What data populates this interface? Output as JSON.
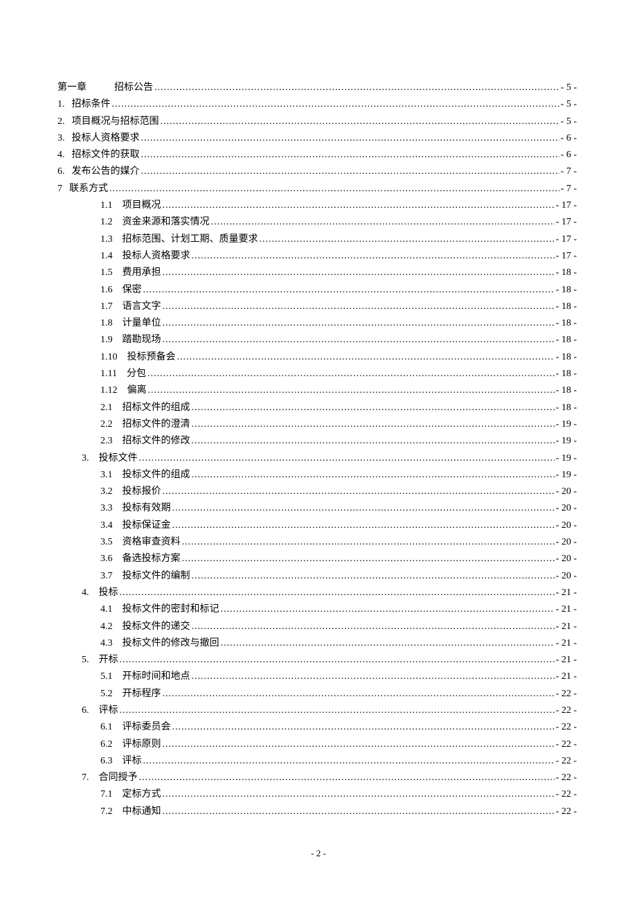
{
  "footer": "- 2 -",
  "toc": [
    {
      "level": 0,
      "label": "第一章",
      "gap": "big",
      "title": "招标公告",
      "page": "- 5 -"
    },
    {
      "level": 0,
      "label": "1.",
      "gap": "small",
      "title": "招标条件",
      "page": "- 5 -"
    },
    {
      "level": 0,
      "label": "2.",
      "gap": "small",
      "title": "项目概况与招标范围",
      "page": "- 5 -"
    },
    {
      "level": 0,
      "label": "3.",
      "gap": "small",
      "title": "投标人资格要求",
      "page": "- 6 -"
    },
    {
      "level": 0,
      "label": "4.",
      "gap": "small",
      "title": "招标文件的获取",
      "page": "- 6 -"
    },
    {
      "level": 0,
      "label": "6.",
      "gap": "small",
      "title": "发布公告的媒介",
      "page": "- 7 -"
    },
    {
      "level": 0,
      "label": "7",
      "gap": "small",
      "title": "联系方式",
      "page": "- 7 -"
    },
    {
      "level": 1,
      "label": "1.1",
      "gap": "med",
      "title": "项目概况",
      "page": "- 17 -"
    },
    {
      "level": 1,
      "label": "1.2",
      "gap": "med",
      "title": "资金来源和落实情况",
      "page": "- 17 -"
    },
    {
      "level": 1,
      "label": "1.3",
      "gap": "med",
      "title": "招标范围、计划工期、质量要求",
      "page": "- 17 -"
    },
    {
      "level": 1,
      "label": "1.4",
      "gap": "med",
      "title": "投标人资格要求",
      "page": "- 17 -"
    },
    {
      "level": 1,
      "label": "1.5",
      "gap": "med",
      "title": "费用承担",
      "page": "- 18 -"
    },
    {
      "level": 1,
      "label": "1.6",
      "gap": "med",
      "title": "保密",
      "page": "- 18 -"
    },
    {
      "level": 1,
      "label": "1.7",
      "gap": "med",
      "title": "语言文字",
      "page": "- 18 -"
    },
    {
      "level": 1,
      "label": "1.8",
      "gap": "med",
      "title": "计量单位",
      "page": "- 18 -"
    },
    {
      "level": 1,
      "label": "1.9",
      "gap": "med",
      "title": "踏勘现场",
      "page": "- 18 -"
    },
    {
      "level": 1,
      "label": "1.10",
      "gap": "med",
      "title": "投标预备会",
      "page": "- 18 -"
    },
    {
      "level": 1,
      "label": "1.11",
      "gap": "med",
      "title": "分包",
      "page": "- 18 -"
    },
    {
      "level": 1,
      "label": "1.12",
      "gap": "med",
      "title": "偏离",
      "page": "- 18 -"
    },
    {
      "level": 1,
      "label": "2.1",
      "gap": "med",
      "title": "招标文件的组成",
      "page": "- 18 -"
    },
    {
      "level": 1,
      "label": "2.2",
      "gap": "med",
      "title": "招标文件的澄清",
      "page": "- 19 -"
    },
    {
      "level": 1,
      "label": "2.3",
      "gap": "med",
      "title": "招标文件的修改",
      "page": "- 19 -"
    },
    {
      "level": 2,
      "label": "3.",
      "gap": "med",
      "title": "投标文件",
      "page": "- 19 -"
    },
    {
      "level": 1,
      "label": "3.1",
      "gap": "med",
      "title": "投标文件的组成",
      "page": "- 19 -"
    },
    {
      "level": 1,
      "label": "3.2",
      "gap": "med",
      "title": "投标报价",
      "page": "- 20 -"
    },
    {
      "level": 1,
      "label": "3.3",
      "gap": "med",
      "title": "投标有效期",
      "page": "- 20 -"
    },
    {
      "level": 1,
      "label": "3.4",
      "gap": "med",
      "title": "投标保证金",
      "page": "- 20 -"
    },
    {
      "level": 1,
      "label": "3.5",
      "gap": "med",
      "title": "资格审查资料",
      "page": "- 20 -"
    },
    {
      "level": 1,
      "label": "3.6",
      "gap": "med",
      "title": "备选投标方案",
      "page": "- 20 -"
    },
    {
      "level": 1,
      "label": "3.7",
      "gap": "med",
      "title": "投标文件的编制",
      "page": "- 20 -"
    },
    {
      "level": 2,
      "label": "4.",
      "gap": "med",
      "title": "投标",
      "page": "- 21 -"
    },
    {
      "level": 1,
      "label": "4.1",
      "gap": "med",
      "title": "投标文件的密封和标记",
      "page": "- 21 -"
    },
    {
      "level": 1,
      "label": "4.2",
      "gap": "med",
      "title": "投标文件的递交",
      "page": "- 21 -"
    },
    {
      "level": 1,
      "label": "4.3",
      "gap": "med",
      "title": "投标文件的修改与撤回",
      "page": "- 21 -"
    },
    {
      "level": 2,
      "label": "5.",
      "gap": "med",
      "title": "开标",
      "page": "- 21 -"
    },
    {
      "level": 1,
      "label": "5.1",
      "gap": "med",
      "title": "开标时间和地点",
      "page": "- 21 -"
    },
    {
      "level": 1,
      "label": "5.2",
      "gap": "med",
      "title": "开标程序",
      "page": "- 22 -"
    },
    {
      "level": 2,
      "label": "6.",
      "gap": "med",
      "title": "评标",
      "page": "- 22 -"
    },
    {
      "level": 1,
      "label": "6.1",
      "gap": "med",
      "title": "评标委员会",
      "page": "- 22 -"
    },
    {
      "level": 1,
      "label": "6.2",
      "gap": "med",
      "title": "评标原则",
      "page": "- 22 -"
    },
    {
      "level": 1,
      "label": "6.3",
      "gap": "med",
      "title": "评标",
      "page": "- 22 -"
    },
    {
      "level": 2,
      "label": "7.",
      "gap": "med",
      "title": "合同授予",
      "page": "- 22 -"
    },
    {
      "level": 1,
      "label": "7.1",
      "gap": "med",
      "title": "定标方式",
      "page": "- 22 -"
    },
    {
      "level": 1,
      "label": "7.2",
      "gap": "med",
      "title": "中标通知",
      "page": "- 22 -"
    }
  ]
}
